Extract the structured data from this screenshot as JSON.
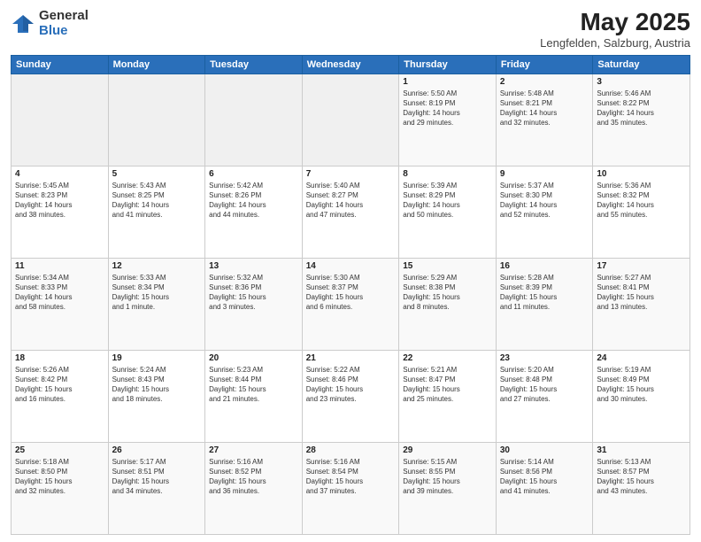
{
  "header": {
    "logo_general": "General",
    "logo_blue": "Blue",
    "month": "May 2025",
    "location": "Lengfelden, Salzburg, Austria"
  },
  "weekdays": [
    "Sunday",
    "Monday",
    "Tuesday",
    "Wednesday",
    "Thursday",
    "Friday",
    "Saturday"
  ],
  "weeks": [
    [
      {
        "day": "",
        "info": ""
      },
      {
        "day": "",
        "info": ""
      },
      {
        "day": "",
        "info": ""
      },
      {
        "day": "",
        "info": ""
      },
      {
        "day": "1",
        "info": "Sunrise: 5:50 AM\nSunset: 8:19 PM\nDaylight: 14 hours\nand 29 minutes."
      },
      {
        "day": "2",
        "info": "Sunrise: 5:48 AM\nSunset: 8:21 PM\nDaylight: 14 hours\nand 32 minutes."
      },
      {
        "day": "3",
        "info": "Sunrise: 5:46 AM\nSunset: 8:22 PM\nDaylight: 14 hours\nand 35 minutes."
      }
    ],
    [
      {
        "day": "4",
        "info": "Sunrise: 5:45 AM\nSunset: 8:23 PM\nDaylight: 14 hours\nand 38 minutes."
      },
      {
        "day": "5",
        "info": "Sunrise: 5:43 AM\nSunset: 8:25 PM\nDaylight: 14 hours\nand 41 minutes."
      },
      {
        "day": "6",
        "info": "Sunrise: 5:42 AM\nSunset: 8:26 PM\nDaylight: 14 hours\nand 44 minutes."
      },
      {
        "day": "7",
        "info": "Sunrise: 5:40 AM\nSunset: 8:27 PM\nDaylight: 14 hours\nand 47 minutes."
      },
      {
        "day": "8",
        "info": "Sunrise: 5:39 AM\nSunset: 8:29 PM\nDaylight: 14 hours\nand 50 minutes."
      },
      {
        "day": "9",
        "info": "Sunrise: 5:37 AM\nSunset: 8:30 PM\nDaylight: 14 hours\nand 52 minutes."
      },
      {
        "day": "10",
        "info": "Sunrise: 5:36 AM\nSunset: 8:32 PM\nDaylight: 14 hours\nand 55 minutes."
      }
    ],
    [
      {
        "day": "11",
        "info": "Sunrise: 5:34 AM\nSunset: 8:33 PM\nDaylight: 14 hours\nand 58 minutes."
      },
      {
        "day": "12",
        "info": "Sunrise: 5:33 AM\nSunset: 8:34 PM\nDaylight: 15 hours\nand 1 minute."
      },
      {
        "day": "13",
        "info": "Sunrise: 5:32 AM\nSunset: 8:36 PM\nDaylight: 15 hours\nand 3 minutes."
      },
      {
        "day": "14",
        "info": "Sunrise: 5:30 AM\nSunset: 8:37 PM\nDaylight: 15 hours\nand 6 minutes."
      },
      {
        "day": "15",
        "info": "Sunrise: 5:29 AM\nSunset: 8:38 PM\nDaylight: 15 hours\nand 8 minutes."
      },
      {
        "day": "16",
        "info": "Sunrise: 5:28 AM\nSunset: 8:39 PM\nDaylight: 15 hours\nand 11 minutes."
      },
      {
        "day": "17",
        "info": "Sunrise: 5:27 AM\nSunset: 8:41 PM\nDaylight: 15 hours\nand 13 minutes."
      }
    ],
    [
      {
        "day": "18",
        "info": "Sunrise: 5:26 AM\nSunset: 8:42 PM\nDaylight: 15 hours\nand 16 minutes."
      },
      {
        "day": "19",
        "info": "Sunrise: 5:24 AM\nSunset: 8:43 PM\nDaylight: 15 hours\nand 18 minutes."
      },
      {
        "day": "20",
        "info": "Sunrise: 5:23 AM\nSunset: 8:44 PM\nDaylight: 15 hours\nand 21 minutes."
      },
      {
        "day": "21",
        "info": "Sunrise: 5:22 AM\nSunset: 8:46 PM\nDaylight: 15 hours\nand 23 minutes."
      },
      {
        "day": "22",
        "info": "Sunrise: 5:21 AM\nSunset: 8:47 PM\nDaylight: 15 hours\nand 25 minutes."
      },
      {
        "day": "23",
        "info": "Sunrise: 5:20 AM\nSunset: 8:48 PM\nDaylight: 15 hours\nand 27 minutes."
      },
      {
        "day": "24",
        "info": "Sunrise: 5:19 AM\nSunset: 8:49 PM\nDaylight: 15 hours\nand 30 minutes."
      }
    ],
    [
      {
        "day": "25",
        "info": "Sunrise: 5:18 AM\nSunset: 8:50 PM\nDaylight: 15 hours\nand 32 minutes."
      },
      {
        "day": "26",
        "info": "Sunrise: 5:17 AM\nSunset: 8:51 PM\nDaylight: 15 hours\nand 34 minutes."
      },
      {
        "day": "27",
        "info": "Sunrise: 5:16 AM\nSunset: 8:52 PM\nDaylight: 15 hours\nand 36 minutes."
      },
      {
        "day": "28",
        "info": "Sunrise: 5:16 AM\nSunset: 8:54 PM\nDaylight: 15 hours\nand 37 minutes."
      },
      {
        "day": "29",
        "info": "Sunrise: 5:15 AM\nSunset: 8:55 PM\nDaylight: 15 hours\nand 39 minutes."
      },
      {
        "day": "30",
        "info": "Sunrise: 5:14 AM\nSunset: 8:56 PM\nDaylight: 15 hours\nand 41 minutes."
      },
      {
        "day": "31",
        "info": "Sunrise: 5:13 AM\nSunset: 8:57 PM\nDaylight: 15 hours\nand 43 minutes."
      }
    ]
  ]
}
